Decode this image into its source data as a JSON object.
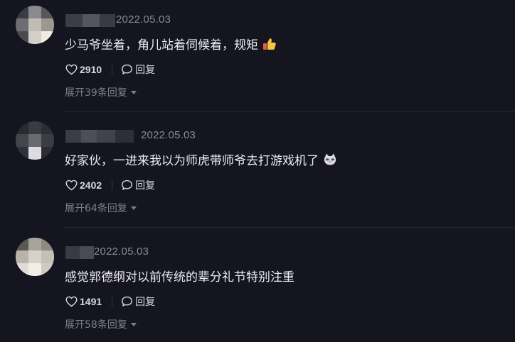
{
  "comments": [
    {
      "date": "2022.05.03",
      "text": "少马爷坐着，角儿站着伺候着，规矩",
      "emoji": "thumbs-up-icon",
      "likes": "2910",
      "reply_label": "回复",
      "expand_label": "展开39条回复"
    },
    {
      "date": "2022.05.03",
      "text": "好家伙，一进来我以为师虎带师爷去打游戏机了",
      "emoji": "cat-face-icon",
      "likes": "2402",
      "reply_label": "回复",
      "expand_label": "展开64条回复"
    },
    {
      "date": "2022.05.03",
      "text": "感觉郭德纲对以前传统的辈分礼节特别注重",
      "emoji": "",
      "likes": "1491",
      "reply_label": "回复",
      "expand_label": "展开58条回复"
    }
  ],
  "colors": {
    "background": "#15151f",
    "text": "#ececf0",
    "muted": "#80808a",
    "date": "#8a8a94"
  }
}
